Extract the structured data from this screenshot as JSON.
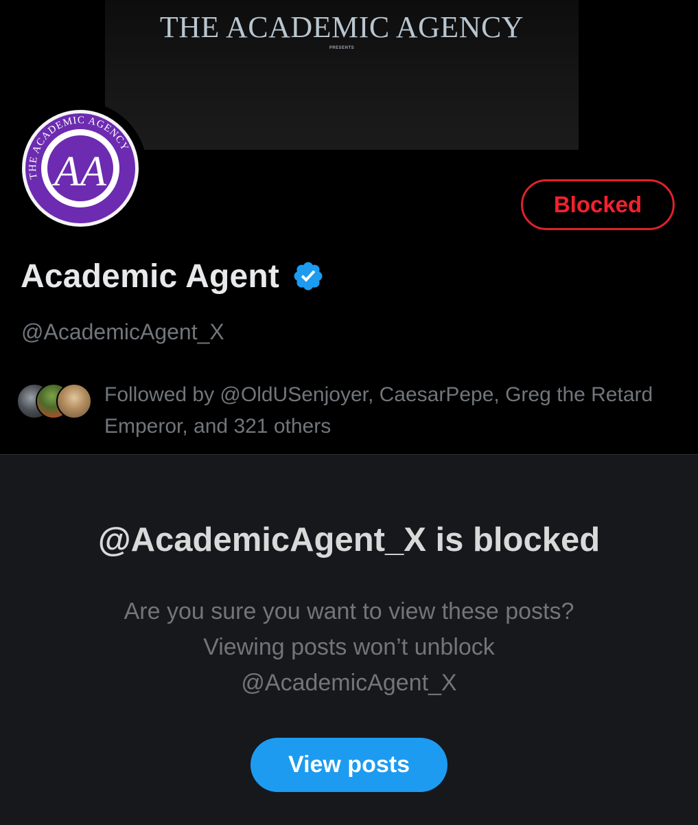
{
  "banner": {
    "title": "THE ACADEMIC AGENCY",
    "subtitle": "PRESENTS"
  },
  "avatar": {
    "ring_text": "THE ACADEMIC AGENCY",
    "initials": "AA",
    "colors": {
      "ring": "#6c2bb0",
      "inner": "#ffffff"
    }
  },
  "profile": {
    "display_name": "Academic Agent",
    "handle": "@AcademicAgent_X",
    "verified_icon": "verified-badge-icon",
    "action_button_label": "Blocked",
    "followed_by": "Followed by @OldUSenjoyer, CaesarPepe, Greg the Retard Emperor, and 321 others"
  },
  "blocked_notice": {
    "title": "@AcademicAgent_X is blocked",
    "description": "Are you sure you want to view these posts? Viewing posts won’t unblock @AcademicAgent_X",
    "button_label": "View posts"
  },
  "colors": {
    "background": "#000000",
    "panel": "#16181c",
    "accent_blue": "#1d9bf0",
    "blocked_red": "#f4212e",
    "muted_text": "#71767b",
    "primary_text": "#e7e9ea"
  }
}
